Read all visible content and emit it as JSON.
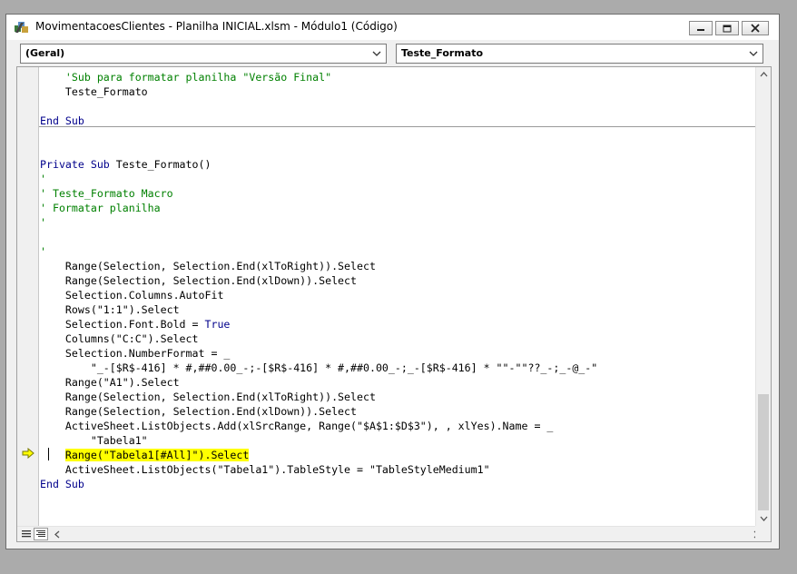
{
  "window": {
    "title": "MovimentacoesClientes - Planilha INICIAL.xlsm - Módulo1 (Código)",
    "icon": "vba-module-icon"
  },
  "controls": {
    "minimize": "minimize-icon",
    "maximize": "maximize-icon",
    "close": "close-icon"
  },
  "object_combo": {
    "value": "(Geral)"
  },
  "procedure_combo": {
    "value": "Teste_Formato"
  },
  "colors": {
    "keyword": "#00008b",
    "comment": "#008000",
    "highlight": "#ffff00",
    "execution_arrow": "#ffff00"
  },
  "code": {
    "lines": [
      [
        {
          "t": "    "
        },
        {
          "t": "'Sub para formatar planilha \"Versão Final\"",
          "c": "cm"
        }
      ],
      [
        {
          "t": "    Teste_Formato"
        }
      ],
      [
        {
          "t": ""
        }
      ],
      [
        {
          "t": "End Sub",
          "c": "kw"
        }
      ],
      [
        {
          "t": ""
        }
      ],
      [
        {
          "t": ""
        }
      ],
      [
        {
          "t": "Private Sub",
          "c": "kw"
        },
        {
          "t": " Teste_Formato()"
        }
      ],
      [
        {
          "t": "'",
          "c": "cm"
        }
      ],
      [
        {
          "t": "' Teste_Formato Macro",
          "c": "cm"
        }
      ],
      [
        {
          "t": "' Formatar planilha",
          "c": "cm"
        }
      ],
      [
        {
          "t": "'",
          "c": "cm"
        }
      ],
      [
        {
          "t": ""
        }
      ],
      [
        {
          "t": "'",
          "c": "cm"
        }
      ],
      [
        {
          "t": "    Range(Selection, Selection.End(xlToRight)).Select"
        }
      ],
      [
        {
          "t": "    Range(Selection, Selection.End(xlDown)).Select"
        }
      ],
      [
        {
          "t": "    Selection.Columns.AutoFit"
        }
      ],
      [
        {
          "t": "    Rows(\"1:1\").Select"
        }
      ],
      [
        {
          "t": "    Selection.Font.Bold = "
        },
        {
          "t": "True",
          "c": "kw"
        }
      ],
      [
        {
          "t": "    Columns(\"C:C\").Select"
        }
      ],
      [
        {
          "t": "    Selection.NumberFormat = _"
        }
      ],
      [
        {
          "t": "        \"_-[$R$-416] * #,##0.00_-;-[$R$-416] * #,##0.00_-;_-[$R$-416] * \"\"-\"\"??_-;_-@_-\""
        }
      ],
      [
        {
          "t": "    Range(\"A1\").Select"
        }
      ],
      [
        {
          "t": "    Range(Selection, Selection.End(xlToRight)).Select"
        }
      ],
      [
        {
          "t": "    Range(Selection, Selection.End(xlDown)).Select"
        }
      ],
      [
        {
          "t": "    ActiveSheet.ListObjects.Add(xlSrcRange, Range(\"$A$1:$D$3\"), , xlYes).Name = _"
        }
      ],
      [
        {
          "t": "        \"Tabela1\""
        }
      ],
      [
        {
          "t": "    "
        },
        {
          "t": "Range(\"Tabela1[#All]\").Select",
          "c": "hl"
        }
      ],
      [
        {
          "t": "    ActiveSheet.ListObjects(\"Tabela1\").TableStyle = \"TableStyleMedium1\""
        }
      ],
      [
        {
          "t": "End Sub",
          "c": "kw"
        }
      ]
    ]
  },
  "margin": {
    "arrow_icon": "execution-point-arrow-icon"
  },
  "scrollbars": {
    "up": "scroll-up-icon",
    "down": "scroll-down-icon",
    "left": "scroll-left-icon",
    "right": "scroll-right-icon",
    "view_procedure": "procedure-view-icon",
    "view_full": "full-module-view-icon"
  }
}
